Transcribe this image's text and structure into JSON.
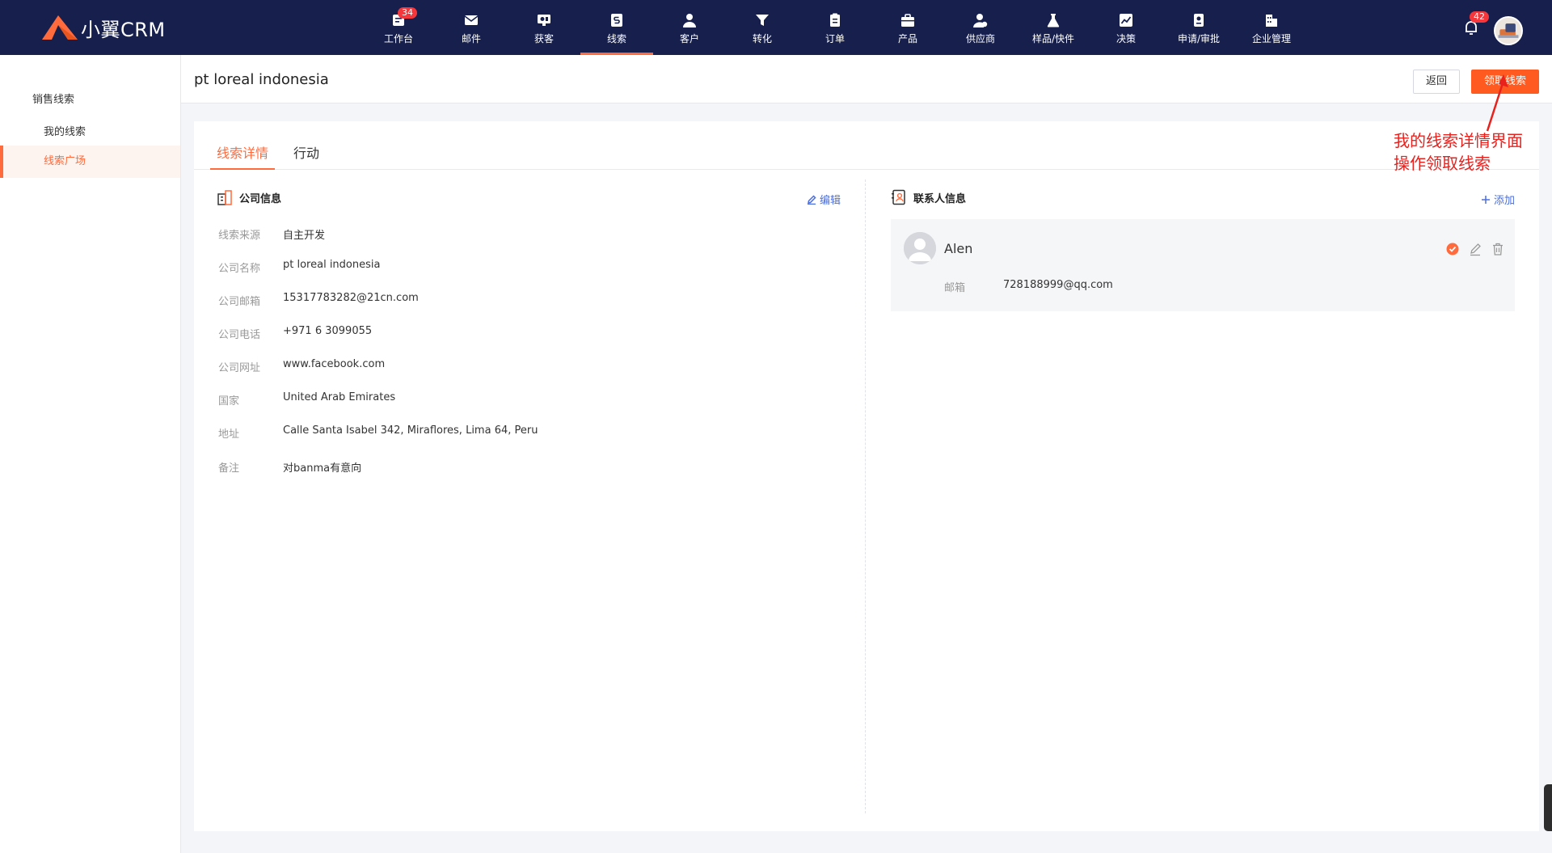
{
  "app": {
    "logo_text": "小翼CRM"
  },
  "nav": [
    {
      "label": "工作台",
      "icon": "dashboard-icon",
      "badge": "34"
    },
    {
      "label": "邮件",
      "icon": "mail-icon"
    },
    {
      "label": "获客",
      "icon": "acquire-icon"
    },
    {
      "label": "线索",
      "icon": "leads-icon",
      "active": true
    },
    {
      "label": "客户",
      "icon": "customer-icon"
    },
    {
      "label": "转化",
      "icon": "funnel-icon"
    },
    {
      "label": "订单",
      "icon": "order-icon"
    },
    {
      "label": "产品",
      "icon": "product-icon"
    },
    {
      "label": "供应商",
      "icon": "supplier-icon"
    },
    {
      "label": "样品/快件",
      "icon": "sample-icon"
    },
    {
      "label": "决策",
      "icon": "decision-icon"
    },
    {
      "label": "申请/审批",
      "icon": "approval-icon"
    },
    {
      "label": "企业管理",
      "icon": "enterprise-icon"
    }
  ],
  "notifications": {
    "count": "42"
  },
  "sidebar": {
    "group": "销售线索",
    "items": [
      {
        "label": "我的线索"
      },
      {
        "label": "线索广场",
        "active": true
      }
    ]
  },
  "header": {
    "title": "pt loreal indonesia",
    "back_label": "返回",
    "claim_label": "领取线索"
  },
  "tabs": [
    {
      "label": "线索详情",
      "active": true
    },
    {
      "label": "行动"
    }
  ],
  "company": {
    "title": "公司信息",
    "edit_label": "编辑",
    "fields": [
      {
        "label": "线索来源",
        "value": "自主开发"
      },
      {
        "label": "公司名称",
        "value": "pt loreal indonesia"
      },
      {
        "label": "公司邮箱",
        "value": "15317783282@21cn.com"
      },
      {
        "label": "公司电话",
        "value": "+971 6 3099055"
      },
      {
        "label": "公司网址",
        "value": "www.facebook.com"
      },
      {
        "label": "国家",
        "value": "United Arab Emirates"
      },
      {
        "label": "地址",
        "value": "Calle Santa Isabel 342, Miraflores, Lima 64, Peru"
      },
      {
        "label": "备注",
        "value": "对banma有意向"
      }
    ]
  },
  "contacts": {
    "title": "联系人信息",
    "add_label": "添加",
    "items": [
      {
        "name": "Alen",
        "email_label": "邮箱",
        "email": "728188999@qq.com"
      }
    ]
  },
  "annotation": {
    "line1": "我的线索详情界面",
    "line2": "操作领取线索"
  },
  "colors": {
    "nav_bg": "#17204d",
    "accent": "#ff6b3d",
    "primary_btn": "#ff5a1f",
    "link": "#4a6ee0",
    "annotation": "#e8211d"
  }
}
